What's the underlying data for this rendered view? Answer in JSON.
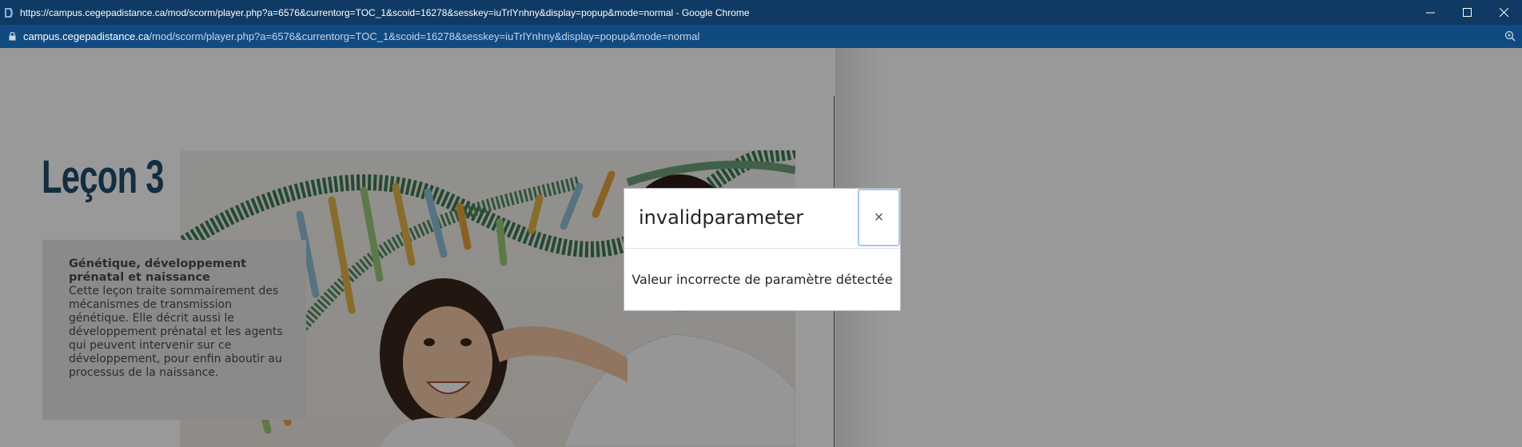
{
  "browser": {
    "window_title": "https://campus.cegepadistance.ca/mod/scorm/player.php?a=6576&currentorg=TOC_1&scoid=16278&sesskey=iuTrlYnhny&display=popup&mode=normal - Google Chrome",
    "url_host": "campus.cegepadistance.ca",
    "url_path": "/mod/scorm/player.php?a=6576&currentorg=TOC_1&scoid=16278&sesskey=iuTrlYnhny&display=popup&mode=normal",
    "icons": [
      "site-favicon-icon",
      "minimize-icon",
      "maximize-icon",
      "close-icon",
      "lock-icon",
      "zoom-icon"
    ]
  },
  "slide": {
    "title": "Leçon 3",
    "info_heading": "Génétique, développement prénatal et naissance",
    "info_text": "Cette leçon traite sommairement des mécanismes de transmission génétique. Elle décrit aussi le développement prénatal et les agents qui peuvent intervenir sur ce développement, pour enfin aboutir au processus de la naissance."
  },
  "modal": {
    "title": "invalidparameter",
    "close_symbol": "×",
    "message": "Valeur incorrecte de paramètre détectée"
  },
  "colors": {
    "titlebar": "#0f3a63",
    "addressbar": "#114a80",
    "lesson_title": "#1f4e6b"
  }
}
